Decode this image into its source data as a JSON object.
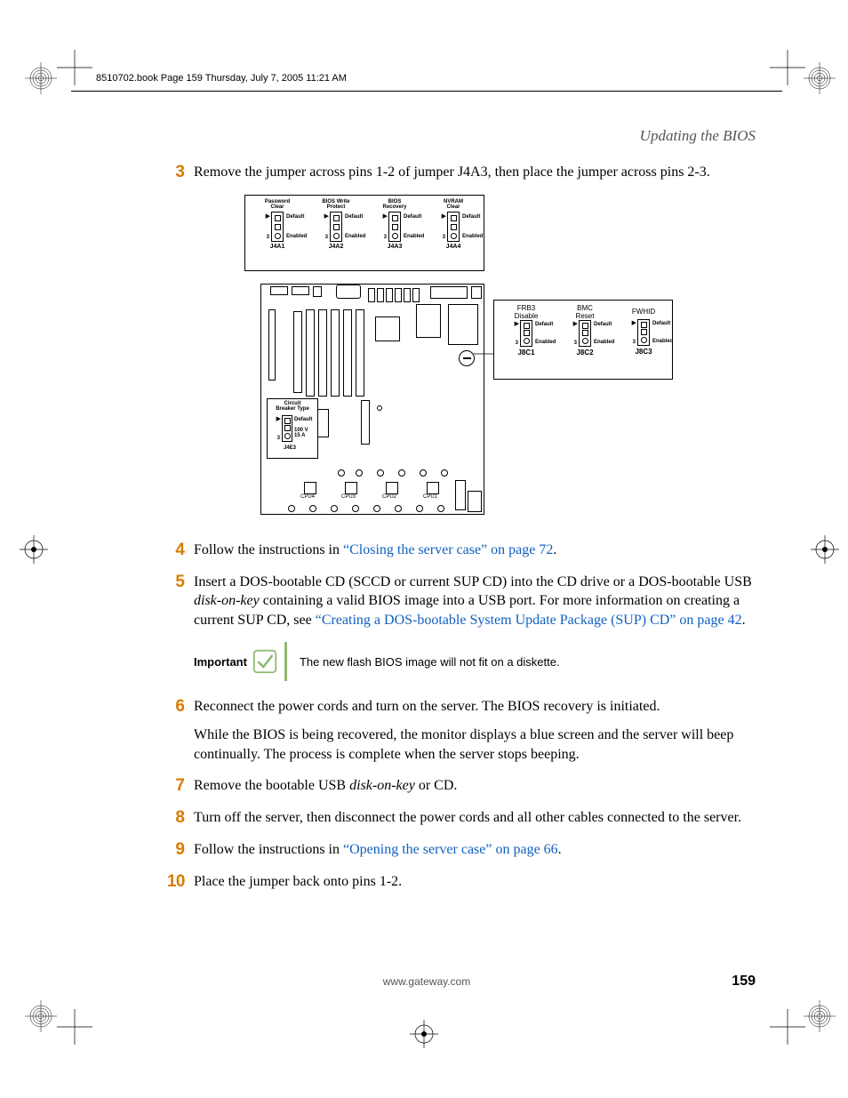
{
  "running_head": "8510702.book  Page 159  Thursday, July 7, 2005  11:21 AM",
  "section_title": "Updating the BIOS",
  "steps": {
    "s3": {
      "num": "3",
      "text": "Remove the jumper across pins 1-2 of jumper J4A3, then place the jumper across pins 2-3."
    },
    "s4": {
      "num": "4",
      "pre": "Follow the instructions in ",
      "link": "“Closing the server case” on page 72",
      "post": "."
    },
    "s5": {
      "num": "5",
      "pre": "Insert a DOS-bootable CD (SCCD or current SUP CD) into the CD drive or a DOS-bootable USB ",
      "italic1": "disk-on-key",
      "mid": " containing a valid BIOS image into a USB port. For more information on creating a current SUP CD, see ",
      "link": "“Creating a DOS-bootable System Update Package (SUP) CD” on page 42",
      "post": "."
    },
    "s6": {
      "num": "6",
      "text": "Reconnect the power cords and turn on the server. The BIOS recovery is initiated.",
      "cont": "While the BIOS is being recovered, the monitor displays a blue screen and the server will beep continually. The process is complete when the server stops beeping."
    },
    "s7": {
      "num": "7",
      "pre": "Remove the bootable USB ",
      "italic1": "disk-on-key",
      "post": " or CD."
    },
    "s8": {
      "num": "8",
      "text": "Turn off the server, then disconnect the power cords and all other cables connected to the server."
    },
    "s9": {
      "num": "9",
      "pre": "Follow the instructions in ",
      "link": "“Opening the server case” on page 66",
      "post": "."
    },
    "s10": {
      "num": "10",
      "text": "Place the jumper back onto pins 1-2."
    }
  },
  "callout": {
    "label": "Important",
    "text": "The new flash BIOS image will not fit on a diskette."
  },
  "diagram": {
    "top_jumpers": [
      {
        "title": "Password\nClear",
        "ref": "J4A1"
      },
      {
        "title": "BIOS Write\nProtect",
        "ref": "J4A2"
      },
      {
        "title": "BIOS\nRecovery",
        "ref": "J4A3"
      },
      {
        "title": "NVRAM\nClear",
        "ref": "J4A4"
      }
    ],
    "side_jumpers": [
      {
        "title": "FRB3\nDisable",
        "ref": "J8C1"
      },
      {
        "title": "BMC\nReset",
        "ref": "J8C2"
      },
      {
        "title": "FWHID",
        "ref": "J8C3"
      }
    ],
    "inset": {
      "title": "Circuit\nBreaker Type",
      "opt1": "Default",
      "opt2": "100 V\n15 A",
      "ref": "J4E3"
    },
    "labels": {
      "default": "Default",
      "enabled": "Enabled",
      "pin3": "3"
    },
    "cpu_labels": [
      "CPU1",
      "CPU2",
      "CPU3",
      "CPU4"
    ]
  },
  "footer": {
    "url": "www.gateway.com",
    "page": "159"
  }
}
